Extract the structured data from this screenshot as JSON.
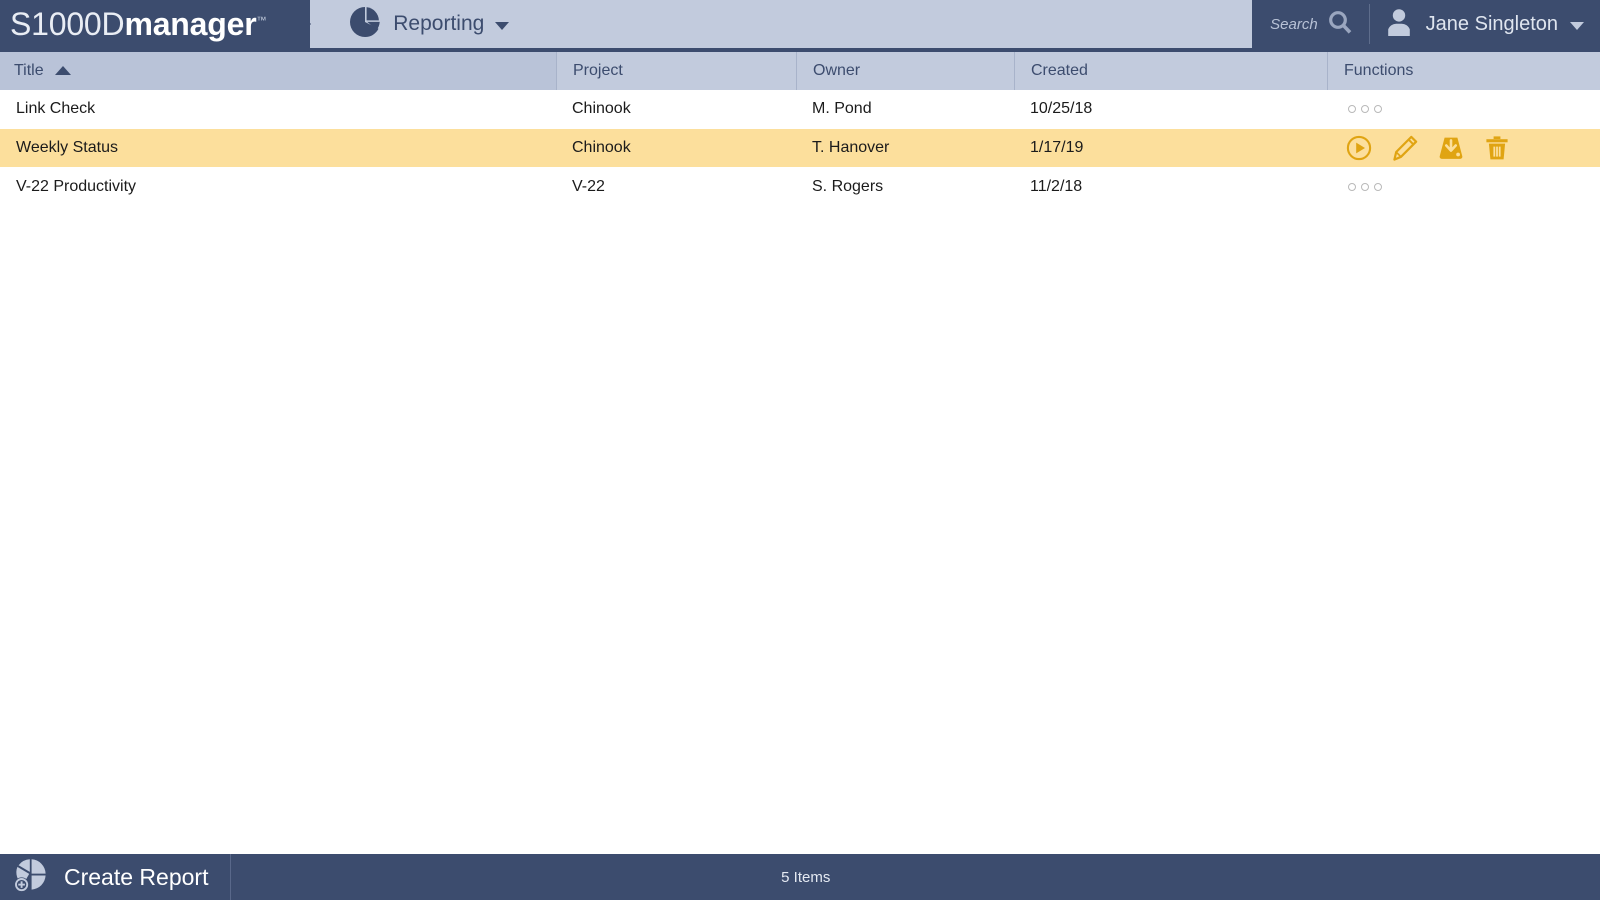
{
  "app": {
    "brand_prefix": "S1000D",
    "brand_suffix": "manager",
    "brand_tm": "™",
    "module_name": "Reporting",
    "module_icon": "pie-chart-icon",
    "chevron_icon": "chevron-down-icon"
  },
  "header": {
    "search_label": "Search",
    "search_icon": "search-icon",
    "user_name": "Jane Singleton",
    "avatar_icon": "user-avatar-icon",
    "user_chevron_icon": "chevron-down-icon"
  },
  "table": {
    "columns": [
      {
        "key": "title",
        "label": "Title",
        "sorted": true,
        "sort_direction": "asc",
        "sort_icon": "chevron-up-icon"
      },
      {
        "key": "project",
        "label": "Project",
        "sorted": false
      },
      {
        "key": "owner",
        "label": "Owner",
        "sorted": false
      },
      {
        "key": "created",
        "label": "Created",
        "sorted": false
      },
      {
        "key": "functions",
        "label": "Functions",
        "sorted": false
      }
    ],
    "rows": [
      {
        "title": "Link Check",
        "project": "Chinook",
        "owner": "M. Pond",
        "created": "10/25/18",
        "selected": false,
        "functions_state": "collapsed",
        "more_icon": "ellipsis-icon"
      },
      {
        "title": "Weekly Status",
        "project": "Chinook",
        "owner": "T. Hanover",
        "created": "1/17/19",
        "selected": true,
        "functions_state": "expanded",
        "actions": [
          {
            "name": "run-report-button",
            "icon": "play-circle-icon",
            "tooltip": "Run"
          },
          {
            "name": "edit-report-button",
            "icon": "pencil-icon",
            "tooltip": "Edit"
          },
          {
            "name": "download-report-button",
            "icon": "download-tray-icon",
            "tooltip": "Download"
          },
          {
            "name": "delete-report-button",
            "icon": "trash-icon",
            "tooltip": "Delete"
          }
        ]
      },
      {
        "title": "V-22 Productivity",
        "project": "V-22",
        "owner": "S. Rogers",
        "created": "11/2/18",
        "selected": false,
        "functions_state": "collapsed",
        "more_icon": "ellipsis-icon"
      }
    ]
  },
  "footer": {
    "create_label": "Create Report",
    "create_icon": "pie-chart-plus-icon",
    "item_count": "5 Items"
  },
  "colors": {
    "navy": "#3c4c6e",
    "header_blue": "#c2cbdd",
    "header_blue_sorted": "#b9c3d8",
    "row_selected": "#fcdf9c",
    "action_amber": "#e0a412",
    "text_dark": "#1b1b1b"
  }
}
